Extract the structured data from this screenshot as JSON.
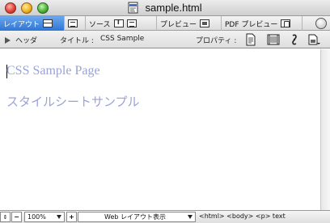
{
  "window": {
    "title": "sample.html"
  },
  "view_tabs": [
    {
      "label": "レイアウト",
      "active": true
    },
    {
      "label": "ソース",
      "active": false
    },
    {
      "label": "プレビュー",
      "active": false
    },
    {
      "label": "PDF プレビュー",
      "active": false
    }
  ],
  "info_bar": {
    "head_label": "ヘッダ",
    "title_label": "タイトル :",
    "title_value": "CSS Sample",
    "properties_label": "プロパティ :"
  },
  "document": {
    "heading": "CSS Sample Page",
    "subheading": "スタイルシートサンプル",
    "text_color": "#9aa2d8"
  },
  "status_bar": {
    "zoom": "100%",
    "view_mode": "Web レイアウト表示",
    "path": "<html> <body> <p> text"
  },
  "colors": {
    "active_tab": "#2f75d4"
  }
}
